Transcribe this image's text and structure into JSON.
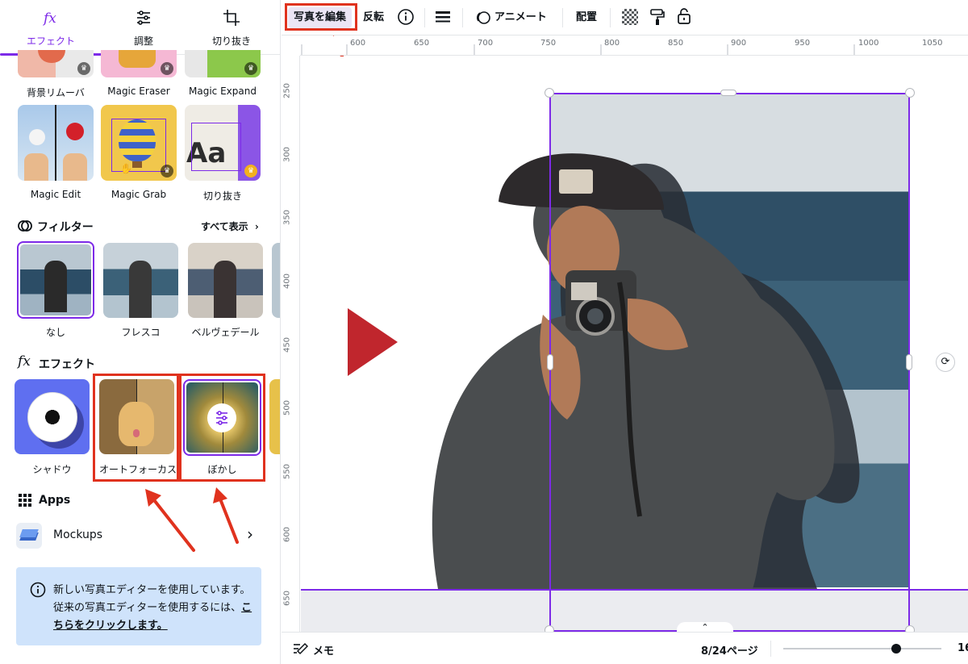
{
  "sidebar": {
    "tabs": [
      {
        "label": "エフェクト",
        "icon": "fx-icon",
        "active": true
      },
      {
        "label": "調整",
        "icon": "sliders-icon",
        "active": false
      },
      {
        "label": "切り抜き",
        "icon": "crop-icon",
        "active": false
      }
    ],
    "magic_tools_row1": [
      {
        "label": "背景リムーバ"
      },
      {
        "label": "Magic Eraser"
      },
      {
        "label": "Magic Expand"
      }
    ],
    "magic_tools_row2": [
      {
        "label": "Magic Edit"
      },
      {
        "label": "Magic Grab"
      },
      {
        "label": "切り抜き"
      }
    ],
    "filters": {
      "title": "フィルター",
      "see_all": "すべて表示",
      "items": [
        {
          "label": "なし",
          "selected": true
        },
        {
          "label": "フレスコ"
        },
        {
          "label": "ベルヴェデール"
        }
      ]
    },
    "effects": {
      "title": "エフェクト",
      "items": [
        {
          "label": "シャドウ"
        },
        {
          "label": "オートフォーカス"
        },
        {
          "label": "ぼかし",
          "selected": true
        }
      ]
    },
    "apps": {
      "title": "Apps",
      "items": [
        {
          "label": "Mockups"
        }
      ]
    },
    "info": {
      "text": "新しい写真エディターを使用しています。従来の写真エディターを使用するには、",
      "link": "こちらをクリックします。"
    }
  },
  "toolbar": {
    "edit_photo": "写真を編集",
    "flip": "反転",
    "animate": "アニメート",
    "position": "配置"
  },
  "rulers": {
    "horizontal": [
      "600",
      "650",
      "700",
      "750",
      "800",
      "850",
      "900",
      "950",
      "1000",
      "1050"
    ],
    "vertical": [
      "250",
      "300",
      "350",
      "400",
      "450",
      "500",
      "550",
      "600",
      "650"
    ]
  },
  "bottombar": {
    "notes": "メモ",
    "page_indicator": "8/24ページ",
    "zoom_partial": "16"
  },
  "colors": {
    "accent": "#7d2ae8",
    "annotation": "#e0321e",
    "play_triangle": "#c0262d",
    "info_bg": "#cfe3fb"
  }
}
